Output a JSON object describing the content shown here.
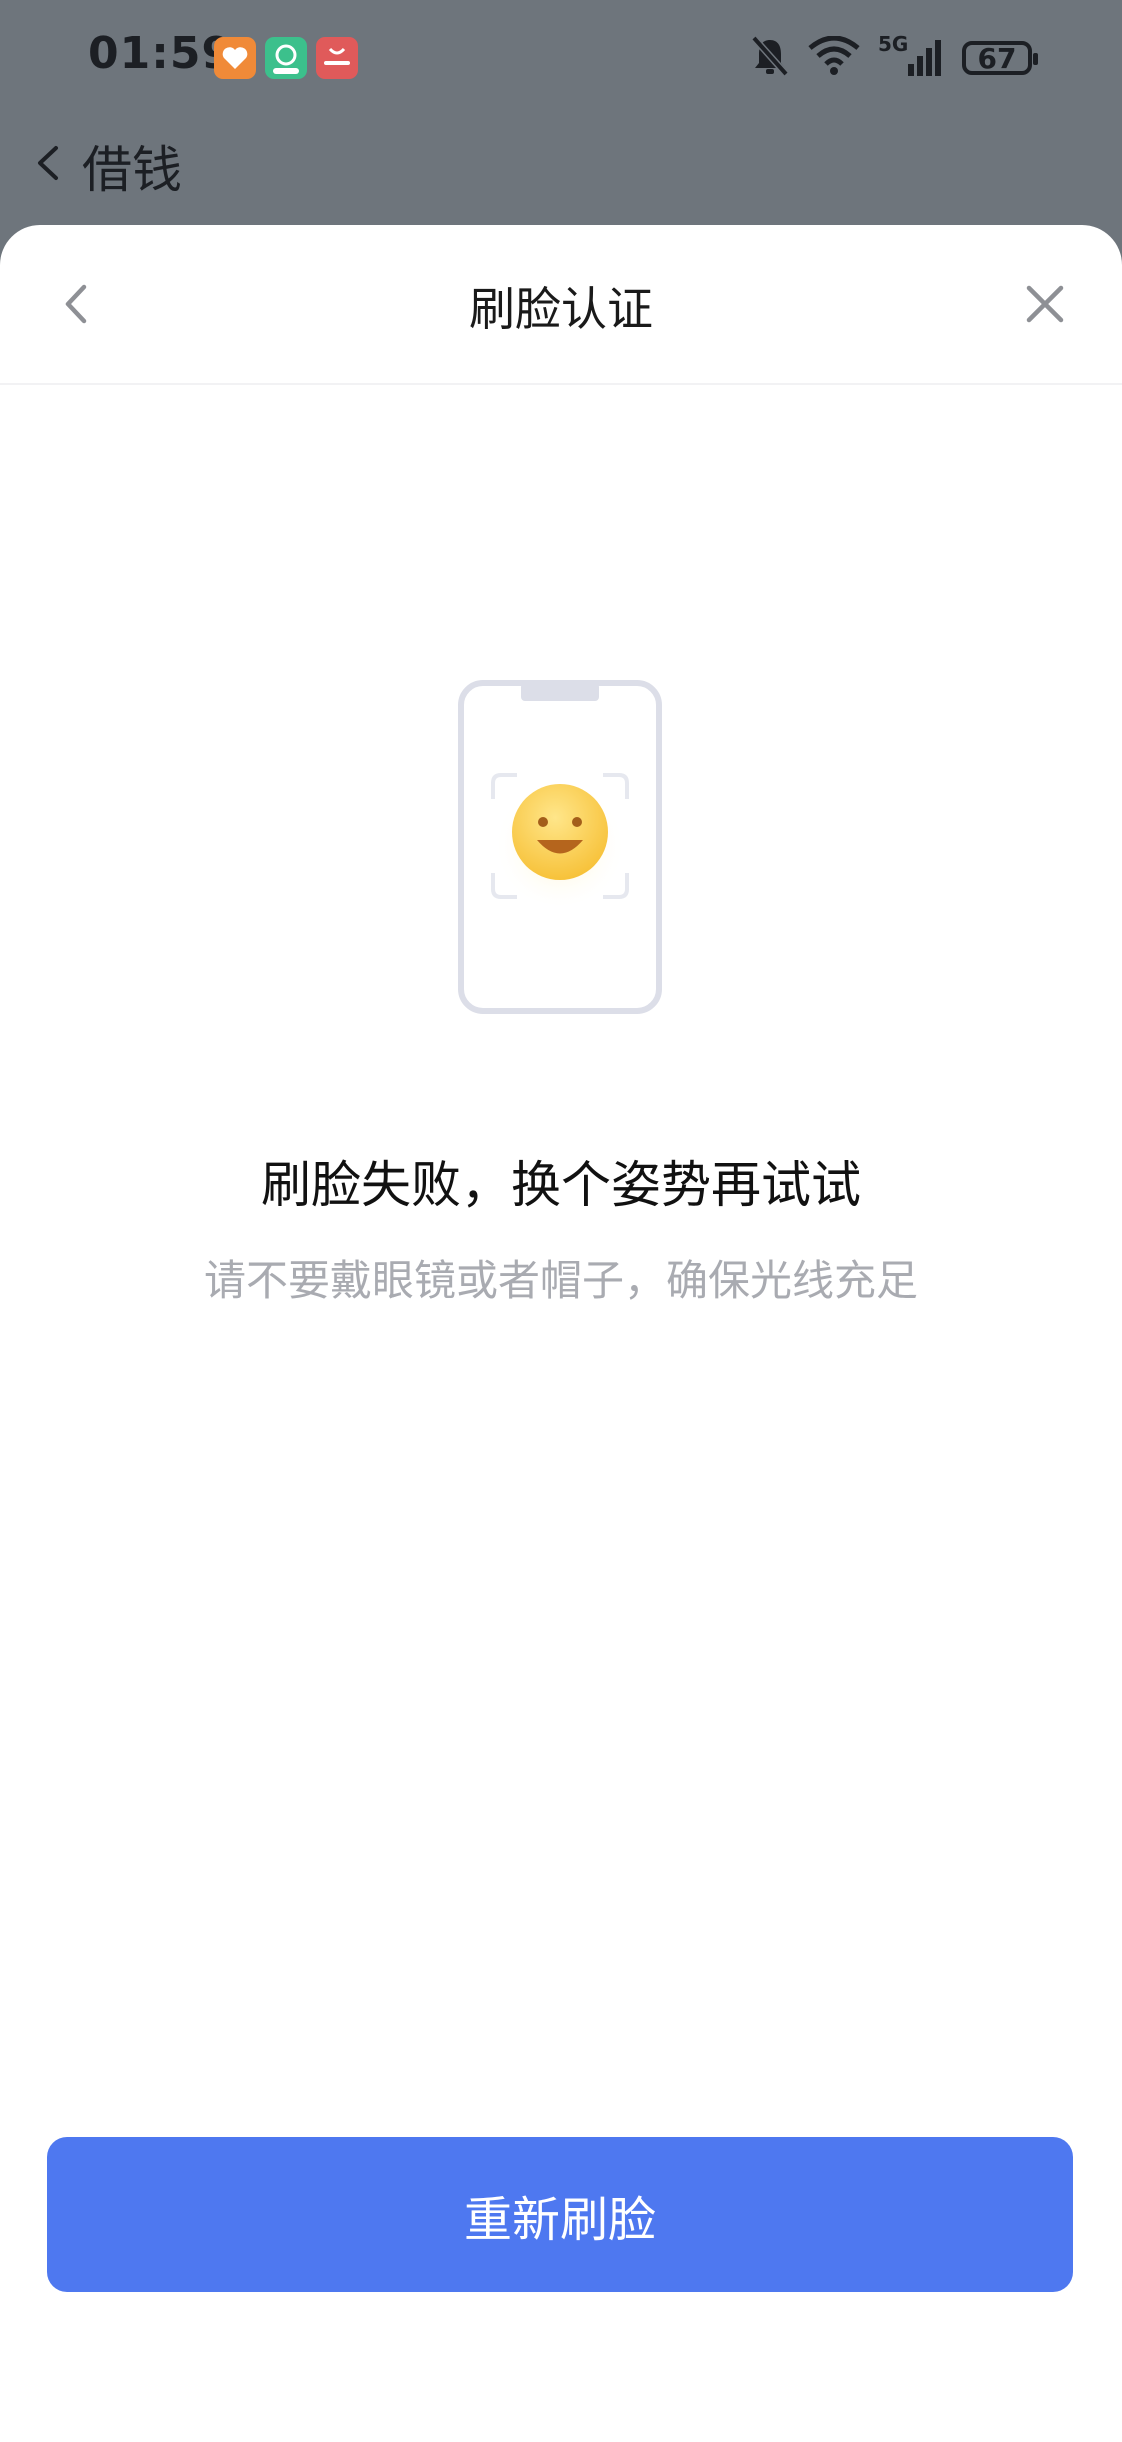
{
  "status_bar": {
    "time": "01:59",
    "network_label": "5G",
    "battery_level": "67"
  },
  "background_page": {
    "title": "借钱"
  },
  "sheet": {
    "title": "刷脸认证",
    "result_title": "刷脸失败，换个姿势再试试",
    "result_hint": "请不要戴眼镜或者帽子，确保光线充足",
    "retry_label": "重新刷脸"
  },
  "colors": {
    "accent": "#4e78f0",
    "overlay": "#6e757c",
    "face": "#ffd24a"
  },
  "icons": {
    "back": "chevron-left-icon",
    "close": "close-icon",
    "illustration": "phone-face-scan-icon"
  }
}
